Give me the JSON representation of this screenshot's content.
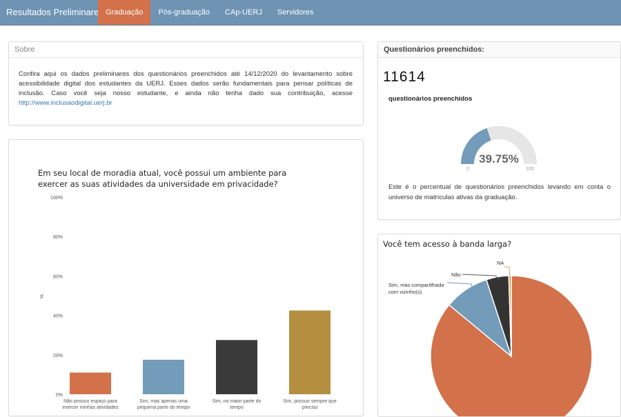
{
  "nav": {
    "brand": "Resultados Preliminares",
    "items": [
      {
        "label": "Graduação",
        "active": true
      },
      {
        "label": "Pós-graduação",
        "active": false
      },
      {
        "label": "CAp-UERJ",
        "active": false
      },
      {
        "label": "Servidores",
        "active": false
      }
    ]
  },
  "sobre": {
    "heading": "Sobre",
    "text": "Confira aqui os dados preliminares dos questionários preenchidos até 14/12/2020 do levantamento sobre acessibilidade digital dos estudantes da UERJ. Esses dados serão fundamentais para pensar políticas de inclusão. Caso você seja nosso estudante, e ainda não tenha dado sua contribuição, acesse",
    "link": "http://www.inclusaodigital.uerj.br"
  },
  "questionarios": {
    "heading": "Questionários preenchidos:",
    "count": "11614",
    "caption": "questionários preenchidos",
    "gauge_value": 39.75,
    "gauge_label": "39.75%",
    "gauge_min": "0",
    "gauge_max": "100",
    "description": "Este é o percentual de questionários preenchidos levando em conta o universo de matrículas ativas da graduação."
  },
  "chart_data": [
    {
      "type": "bar",
      "title": "Em seu local de moradia atual, você possui um ambiente para exercer as suas atividades da universidade em privacidade?",
      "ylabel": "%",
      "ylim": [
        0,
        100
      ],
      "yticks": [
        "0%",
        "20%",
        "40%",
        "60%",
        "80%",
        "100%"
      ],
      "categories": [
        [
          "Não possuo espaço para",
          "exercer minhas atividades"
        ],
        [
          "Sim, mas apenas uma",
          "pequena parte do tempo"
        ],
        [
          "Sim, na maior parte do",
          "tempo"
        ],
        [
          "Sim, possuo sempre que",
          "preciso"
        ]
      ],
      "values": [
        11,
        17.5,
        27.5,
        42.5
      ],
      "colors": [
        "#d2714a",
        "#729cb9",
        "#3a3a3a",
        "#b58f40"
      ],
      "grid": false
    },
    {
      "type": "pie",
      "title": "Você tem acesso à banda larga?",
      "slices": [
        {
          "label": "",
          "value": 86,
          "color": "#d2714a"
        },
        {
          "label": "Sim, mas compartilhada com vizinho(s)",
          "value": 9,
          "color": "#729cb9"
        },
        {
          "label": "Não",
          "value": 4.5,
          "color": "#333333"
        },
        {
          "label": "NA",
          "value": 0.5,
          "color": "#e0a050"
        }
      ]
    }
  ],
  "colors": {
    "navbar": "#6e93b3",
    "active_tab": "#d2714a"
  }
}
